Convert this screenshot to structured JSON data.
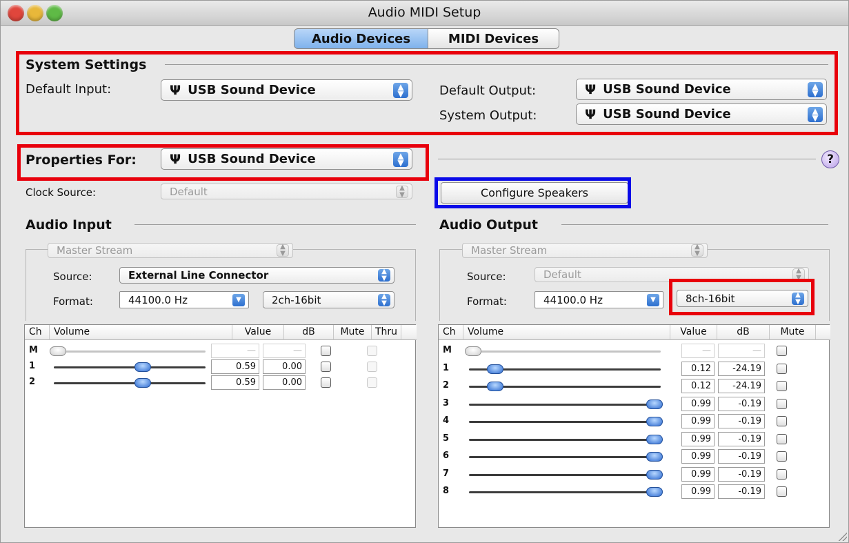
{
  "window": {
    "title": "Audio MIDI Setup",
    "tabs": [
      {
        "label": "Audio Devices",
        "selected": true
      },
      {
        "label": "MIDI Devices",
        "selected": false
      }
    ]
  },
  "system_settings": {
    "heading": "System Settings",
    "default_input_label": "Default Input:",
    "default_input_value": "USB Sound Device",
    "default_output_label": "Default Output:",
    "default_output_value": "USB Sound Device",
    "system_output_label": "System Output:",
    "system_output_value": "USB Sound Device"
  },
  "properties": {
    "label": "Properties For:",
    "value": "USB Sound Device",
    "help_glyph": "?",
    "clock_source_label": "Clock Source:",
    "clock_source_value": "Default",
    "configure_speakers_label": "Configure Speakers"
  },
  "icons": {
    "usb": "usb-icon",
    "help": "help-icon",
    "stepper": "up-down-arrows-icon"
  },
  "glyphs": {
    "usb": "Ψ",
    "stepper_up": "▲",
    "stepper_down": "▼",
    "dash": "—"
  },
  "audio_input": {
    "heading": "Audio Input",
    "stream": "Master Stream",
    "source_label": "Source:",
    "source_value": "External Line Connector",
    "format_label": "Format:",
    "rate_value": "44100.0 Hz",
    "bits_value": "2ch-16bit",
    "columns": [
      "Ch",
      "Volume",
      "Value",
      "dB",
      "Mute",
      "Thru"
    ],
    "rows": [
      {
        "ch": "M",
        "level": 0.0,
        "value": "—",
        "db": "—",
        "enabled": false
      },
      {
        "ch": "1",
        "level": 0.59,
        "value": "0.59",
        "db": "0.00",
        "enabled": true
      },
      {
        "ch": "2",
        "level": 0.59,
        "value": "0.59",
        "db": "0.00",
        "enabled": true
      }
    ]
  },
  "audio_output": {
    "heading": "Audio Output",
    "stream": "Master Stream",
    "source_label": "Source:",
    "source_value": "Default",
    "format_label": "Format:",
    "rate_value": "44100.0 Hz",
    "bits_value": "8ch-16bit",
    "columns": [
      "Ch",
      "Volume",
      "Value",
      "dB",
      "Mute"
    ],
    "rows": [
      {
        "ch": "M",
        "level": 0.0,
        "value": "—",
        "db": "—",
        "enabled": false
      },
      {
        "ch": "1",
        "level": 0.12,
        "value": "0.12",
        "db": "-24.19",
        "enabled": true
      },
      {
        "ch": "2",
        "level": 0.12,
        "value": "0.12",
        "db": "-24.19",
        "enabled": true
      },
      {
        "ch": "3",
        "level": 0.99,
        "value": "0.99",
        "db": "-0.19",
        "enabled": true
      },
      {
        "ch": "4",
        "level": 0.99,
        "value": "0.99",
        "db": "-0.19",
        "enabled": true
      },
      {
        "ch": "5",
        "level": 0.99,
        "value": "0.99",
        "db": "-0.19",
        "enabled": true
      },
      {
        "ch": "6",
        "level": 0.99,
        "value": "0.99",
        "db": "-0.19",
        "enabled": true
      },
      {
        "ch": "7",
        "level": 0.99,
        "value": "0.99",
        "db": "-0.19",
        "enabled": true
      },
      {
        "ch": "8",
        "level": 0.99,
        "value": "0.99",
        "db": "-0.19",
        "enabled": true
      }
    ]
  },
  "colors": {
    "highlight_red": "#e8000b",
    "highlight_blue": "#0a0ae8",
    "selected_tab": "#7fb2ec",
    "close_button": "#e0463c",
    "minimize_button": "#e8b83a",
    "zoom_button": "#5fba46"
  }
}
